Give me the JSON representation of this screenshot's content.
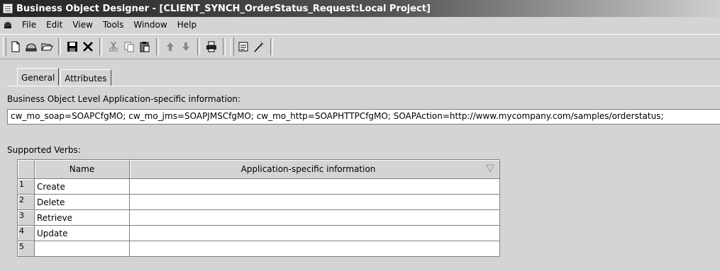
{
  "window": {
    "title": "Business Object Designer - [CLIENT_SYNCH_OrderStatus_Request:Local Project]"
  },
  "menu": [
    "File",
    "Edit",
    "View",
    "Tools",
    "Window",
    "Help"
  ],
  "tabs": [
    {
      "label": "General",
      "active": true
    },
    {
      "label": "Attributes",
      "active": false
    }
  ],
  "bo_level": {
    "label": "Business Object Level Application-specific information:",
    "value": "cw_mo_soap=SOAPCfgMO; cw_mo_jms=SOAPJMSCfgMO; cw_mo_http=SOAPHTTPCfgMO; SOAPAction=http://www.mycompany.com/samples/orderstatus;"
  },
  "verbs": {
    "label": "Supported Verbs:",
    "columns": [
      "Name",
      "Application-specific information"
    ],
    "rows": [
      {
        "num": "1",
        "name": "Create",
        "info": ""
      },
      {
        "num": "2",
        "name": "Delete",
        "info": ""
      },
      {
        "num": "3",
        "name": "Retrieve",
        "info": ""
      },
      {
        "num": "4",
        "name": "Update",
        "info": ""
      },
      {
        "num": "5",
        "name": "",
        "info": ""
      }
    ]
  }
}
